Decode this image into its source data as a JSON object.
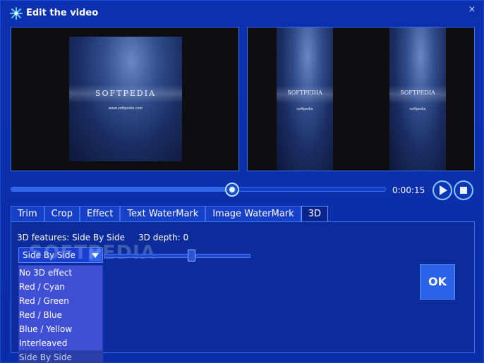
{
  "window": {
    "title": "Edit the video",
    "close_glyph": "×",
    "icon": "sparkle-icon",
    "close_icon": "close-icon"
  },
  "preview": {
    "left": {
      "frame_title": "SOFTPEDIA",
      "frame_url": "www.softpedia.com"
    },
    "right": {
      "frame_title": "SOFTPEDIA",
      "frame_url": "softpedia"
    }
  },
  "playback": {
    "position_fraction": 0.59,
    "time": "0:00:15",
    "play_icon": "play-icon",
    "stop_icon": "stop-icon"
  },
  "tabs": [
    {
      "label": "Trim",
      "active": false
    },
    {
      "label": "Crop",
      "active": false
    },
    {
      "label": "Effect",
      "active": false
    },
    {
      "label": "Text WaterMark",
      "active": false
    },
    {
      "label": "Image WaterMark",
      "active": false
    },
    {
      "label": "3D",
      "active": true
    }
  ],
  "panel_3d": {
    "features_text": "3D features: Side By Side",
    "depth_text": "3D depth: 0",
    "selected_option": "Side By Side",
    "watermark_text": "SOFTPEDIA",
    "depth_fraction": 0.6,
    "options": [
      "No 3D effect",
      "Red / Cyan",
      "Red / Green",
      "Red / Blue",
      "Blue / Yellow",
      "Interleaved",
      "Side By Side"
    ],
    "ok_label": "OK"
  },
  "colors": {
    "background": "#0b2ea6",
    "accent": "#2b63e8",
    "dropdown": "#3f4fd6"
  }
}
